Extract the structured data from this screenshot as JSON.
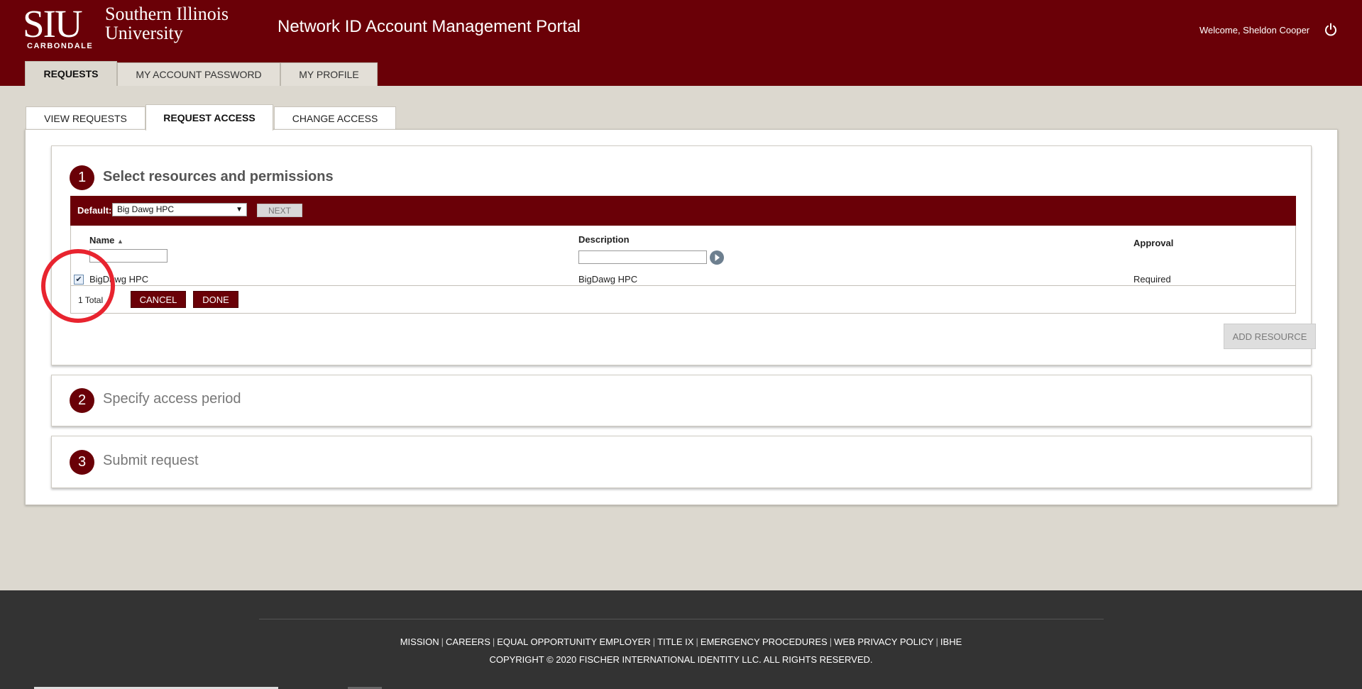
{
  "header": {
    "logo": {
      "mark": "SIU",
      "name": "Southern Illinois University",
      "city": "CARBONDALE"
    },
    "portal_title": "Network ID Account Management Portal",
    "welcome": "Welcome, Sheldon Cooper",
    "power_icon": "power-icon"
  },
  "main_tabs": [
    "REQUESTS",
    "MY ACCOUNT PASSWORD",
    "MY PROFILE"
  ],
  "sub_tabs": [
    "VIEW REQUESTS",
    "REQUEST ACCESS",
    "CHANGE ACCESS"
  ],
  "steps": [
    {
      "number": "1",
      "title": "Select resources and permissions"
    },
    {
      "number": "2",
      "title": "Specify access period"
    },
    {
      "number": "3",
      "title": "Submit request"
    }
  ],
  "toolbar": {
    "default_label": "Default:",
    "default_value": "Big Dawg HPC",
    "next_label": "NEXT"
  },
  "table": {
    "columns": {
      "name": "Name",
      "description": "Description",
      "approval": "Approval"
    },
    "sort": {
      "column": "Name",
      "direction": "ascending"
    },
    "rows": [
      {
        "checked": true,
        "name": "BigDawg HPC",
        "description": "BigDawg HPC",
        "approval": "Required"
      }
    ],
    "total": "1 Total",
    "cancel_label": "CANCEL",
    "done_label": "DONE"
  },
  "add_resource_label": "ADD RESOURCE",
  "footer": {
    "links": [
      "MISSION",
      "CAREERS",
      "EQUAL OPPORTUNITY EMPLOYER",
      "TITLE IX",
      "EMERGENCY PROCEDURES",
      "WEB PRIVACY POLICY",
      "IBHE"
    ],
    "copyright": "COPYRIGHT © 2020 FISCHER INTERNATIONAL IDENTITY LLC. ALL RIGHTS RESERVED."
  },
  "colors": {
    "brand": "#6a0007",
    "background": "#dcd8cf",
    "footer": "#333333",
    "annotation": "#e8242f"
  }
}
